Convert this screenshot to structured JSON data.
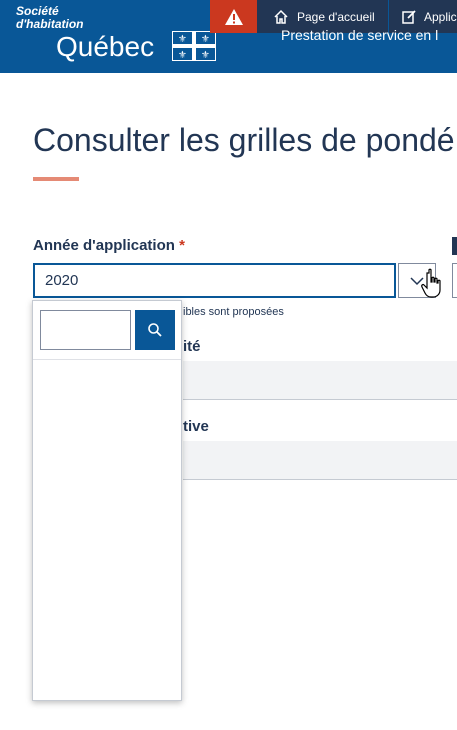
{
  "header": {
    "logo_line1": "Société",
    "logo_line2": "d'habitation",
    "logo_quebec": "Québec",
    "nav_home": "Page d'accueil",
    "nav_app": "Applic",
    "prestation": "Prestation de service en l"
  },
  "main": {
    "title": "Consulter les grilles de pondé",
    "field_label": "Année d'application",
    "required_mark": "*",
    "selected_year": "2020",
    "hint": "ibles sont proposées",
    "section1_label": "ité",
    "section2_label": "tive"
  },
  "dropdown": {
    "search_value": ""
  },
  "colors": {
    "brand": "#095797",
    "alert": "#cb381f",
    "navbar": "#223654",
    "accent_underline": "#e58a75"
  }
}
